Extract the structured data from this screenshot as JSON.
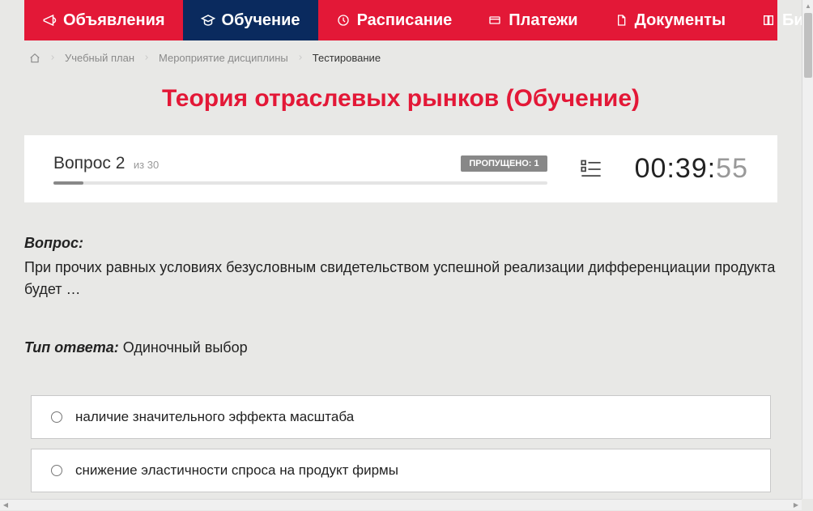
{
  "nav": {
    "items": [
      {
        "label": "Объявления",
        "icon": "megaphone"
      },
      {
        "label": "Обучение",
        "icon": "graduation",
        "active": true
      },
      {
        "label": "Расписание",
        "icon": "clock"
      },
      {
        "label": "Платежи",
        "icon": "card"
      },
      {
        "label": "Документы",
        "icon": "doc"
      },
      {
        "label": "Библиотека",
        "icon": "book",
        "dropdown": true
      }
    ]
  },
  "breadcrumb": {
    "items": [
      "Учебный план",
      "Мероприятие дисциплины"
    ],
    "current": "Тестирование"
  },
  "page_title": "Теория отраслевых рынков (Обучение)",
  "quiz": {
    "question_label": "Вопрос",
    "question_num": "2",
    "of_label": "из",
    "total_label": "30",
    "skipped_label": "ПРОПУЩЕНО: 1",
    "timer": {
      "mm_ss": "00:39:",
      "sec": "55"
    },
    "progress_pct": 6
  },
  "question": {
    "label": "Вопрос:",
    "text": "При прочих равных условиях безусловным свидетельством успешной реализации дифференциации продукта будет …"
  },
  "answer_type": {
    "label": "Тип ответа:",
    "value": "Одиночный выбор"
  },
  "answers": [
    {
      "text": "наличие значительного эффекта масштаба"
    },
    {
      "text": "снижение эластичности спроса на продукт фирмы"
    }
  ]
}
